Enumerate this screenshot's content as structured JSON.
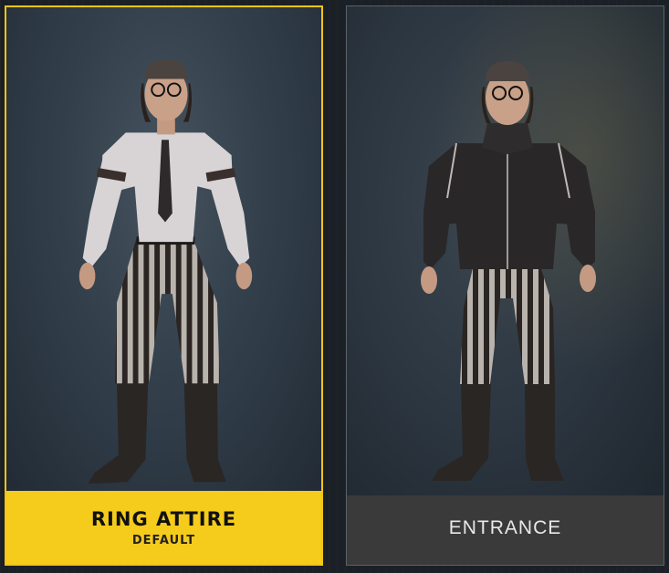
{
  "cards": [
    {
      "title": "RING ATTIRE",
      "subtitle": "DEFAULT",
      "selected": true
    },
    {
      "title": "ENTRANCE",
      "selected": false
    }
  ],
  "colors": {
    "selected_accent": "#f5cb1c",
    "unselected_bar": "#3a3a3a"
  }
}
